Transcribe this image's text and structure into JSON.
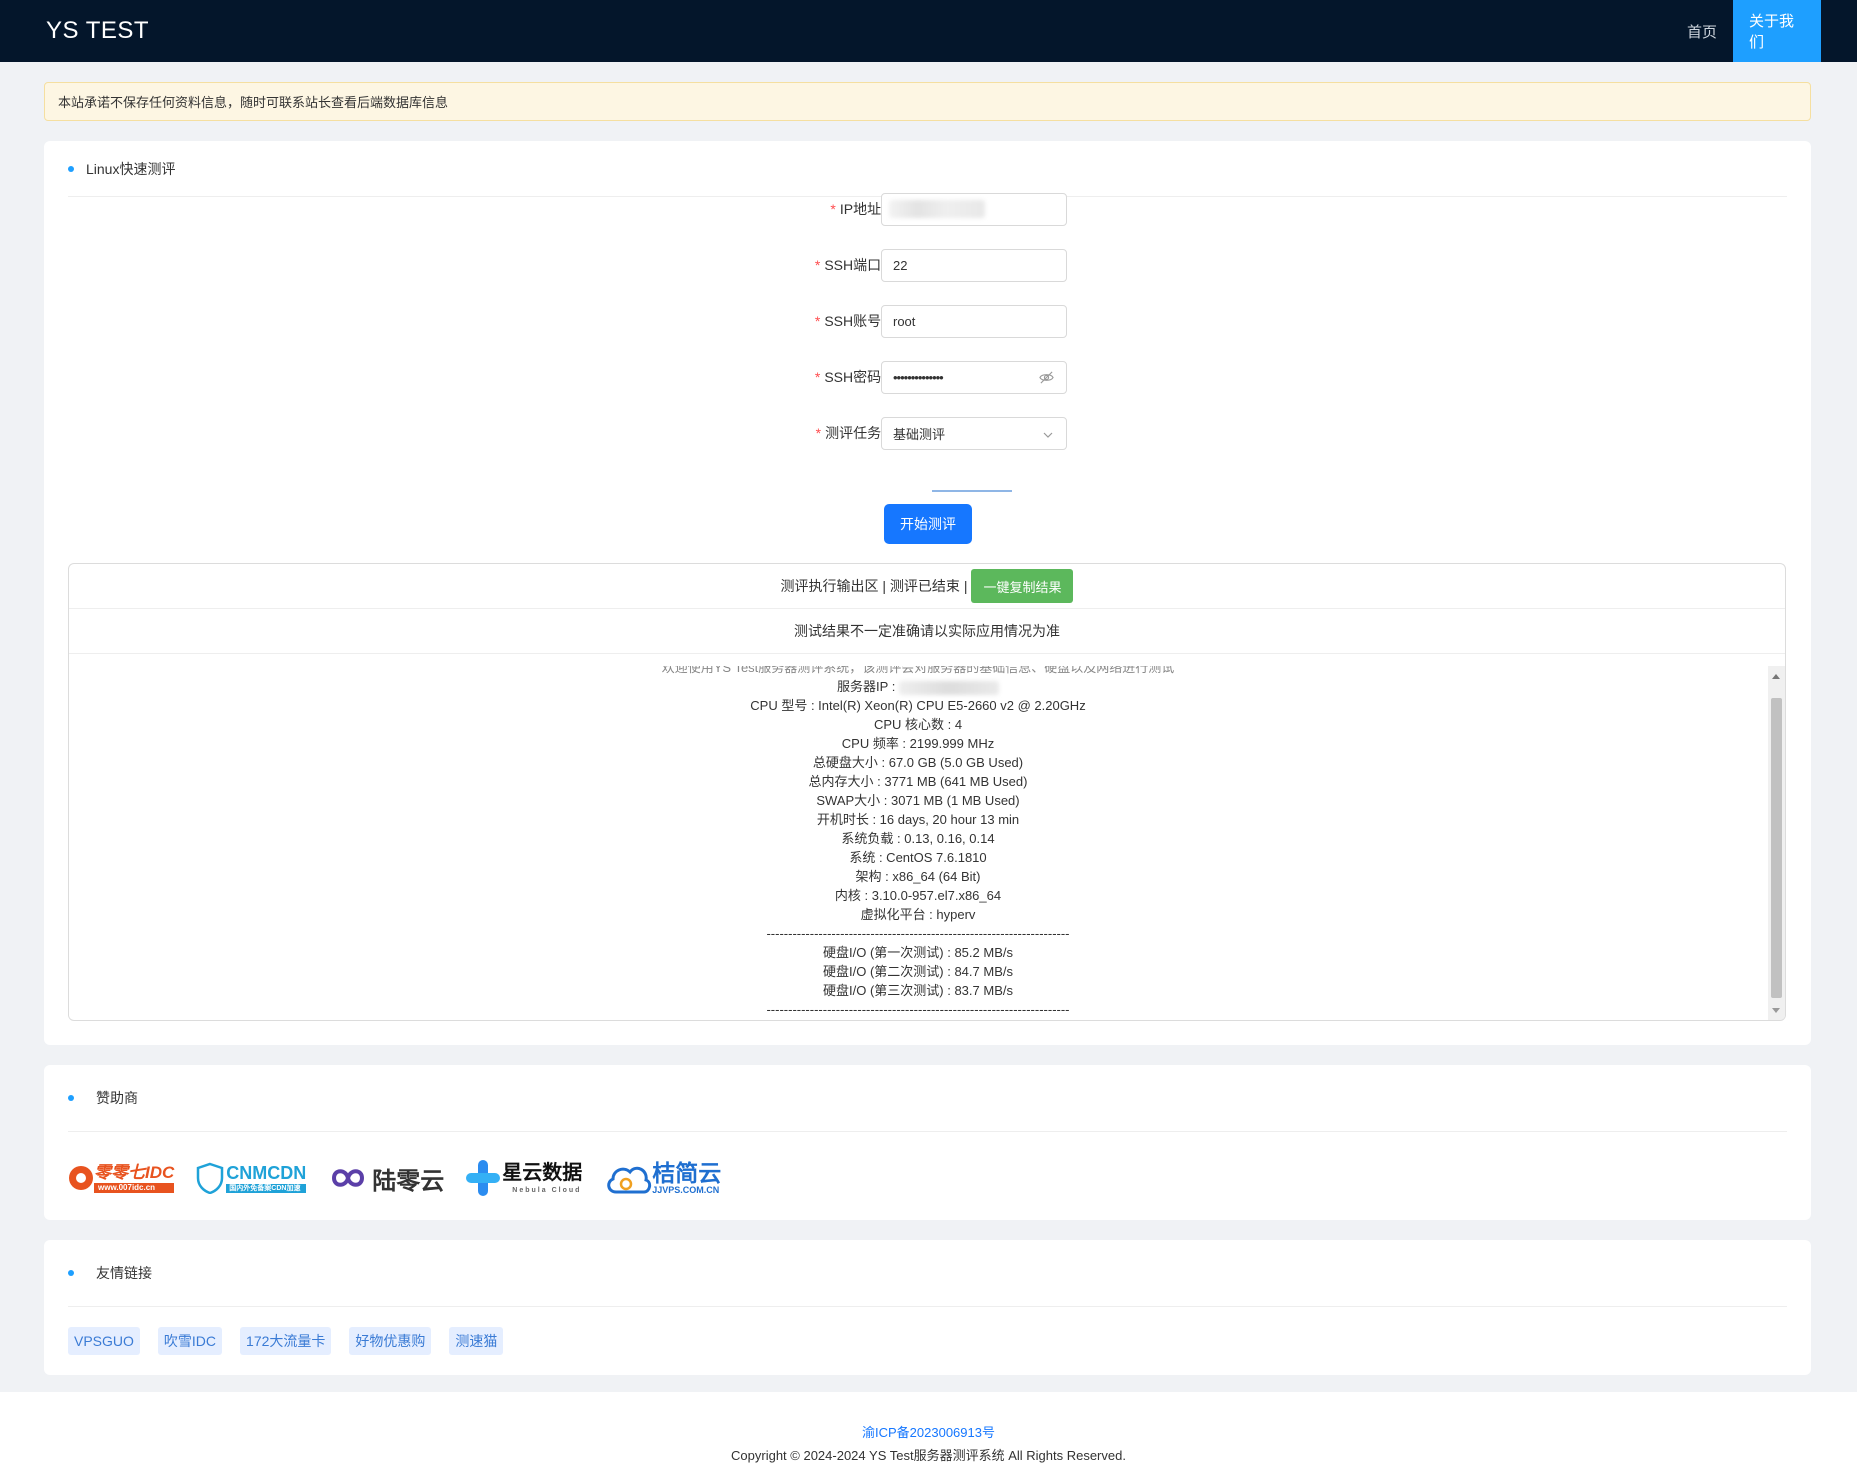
{
  "header": {
    "brand": "YS TEST",
    "nav": [
      {
        "label": "首页"
      },
      {
        "label": "关于我们"
      }
    ]
  },
  "notice": "本站承诺不保存任何资料信息，随时可联系站长查看后端数据库信息",
  "test_card": {
    "title": "Linux快速测评",
    "fields": {
      "ip": {
        "label": "IP地址:"
      },
      "port": {
        "label": "SSH端口:",
        "value": "22"
      },
      "account": {
        "label": "SSH账号:",
        "value": "root"
      },
      "password": {
        "label": "SSH密码:",
        "value": "••••••••••••••"
      },
      "task": {
        "label": "测评任务:",
        "value": "基础测评"
      }
    },
    "start_button": "开始测评",
    "output": {
      "header_text": "测评执行输出区 | 测评已结束 |",
      "copy_button": "一键复制结果",
      "note": "测试结果不一定准确请以实际应用情况为准",
      "cut_line": "欢迎使用YS Test服务器测评系统，该测评会对服务器的基础信息、硬盘以及网络进行测试",
      "server_ip_label": "服务器IP : ",
      "lines": [
        "CPU 型号 : Intel(R) Xeon(R) CPU E5-2660 v2 @ 2.20GHz",
        "CPU 核心数 : 4",
        "CPU 频率 : 2199.999 MHz",
        "总硬盘大小 : 67.0 GB (5.0 GB Used)",
        "总内存大小 : 3771 MB (641 MB Used)",
        "SWAP大小 : 3071 MB (1 MB Used)",
        "开机时长 : 16 days, 20 hour 13 min",
        "系统负载 : 0.13, 0.16, 0.14",
        "系统 : CentOS 7.6.1810",
        "架构 : x86_64 (64 Bit)",
        "内核 : 3.10.0-957.el7.x86_64",
        "虚拟化平台 : hyperv",
        "----------------------------------------------------------------------",
        "硬盘I/O (第一次测试) : 85.2 MB/s",
        "硬盘I/O (第二次测试) : 84.7 MB/s",
        "硬盘I/O (第三次测试) : 83.7 MB/s",
        "----------------------------------------------------------------------"
      ]
    }
  },
  "sponsors": {
    "title": "赞助商",
    "logos": [
      {
        "text": "零零七IDC",
        "sub": "www.007idc.cn",
        "color": "#e8531f"
      },
      {
        "text": "CNMCDN",
        "sub": "国内外免备案CDN加速",
        "color": "#1fa2d8"
      },
      {
        "text": "陆零云",
        "color": "#333333"
      },
      {
        "text": "星云数据",
        "sub": "Nebula Cloud",
        "color": "#111111"
      },
      {
        "text": "桔简云",
        "sub": "JJVPS.COM.CN",
        "color": "#1f6fd0"
      }
    ]
  },
  "links": {
    "title": "友情链接",
    "items": [
      "VPSGUO",
      "吹雪IDC",
      "172大流量卡",
      "好物优惠购",
      "测速猫"
    ]
  },
  "footer": {
    "icp": "渝ICP备2023006913号",
    "copyright": "Copyright © 2024-2024 YS Test服务器测评系统 All Rights Reserved."
  }
}
